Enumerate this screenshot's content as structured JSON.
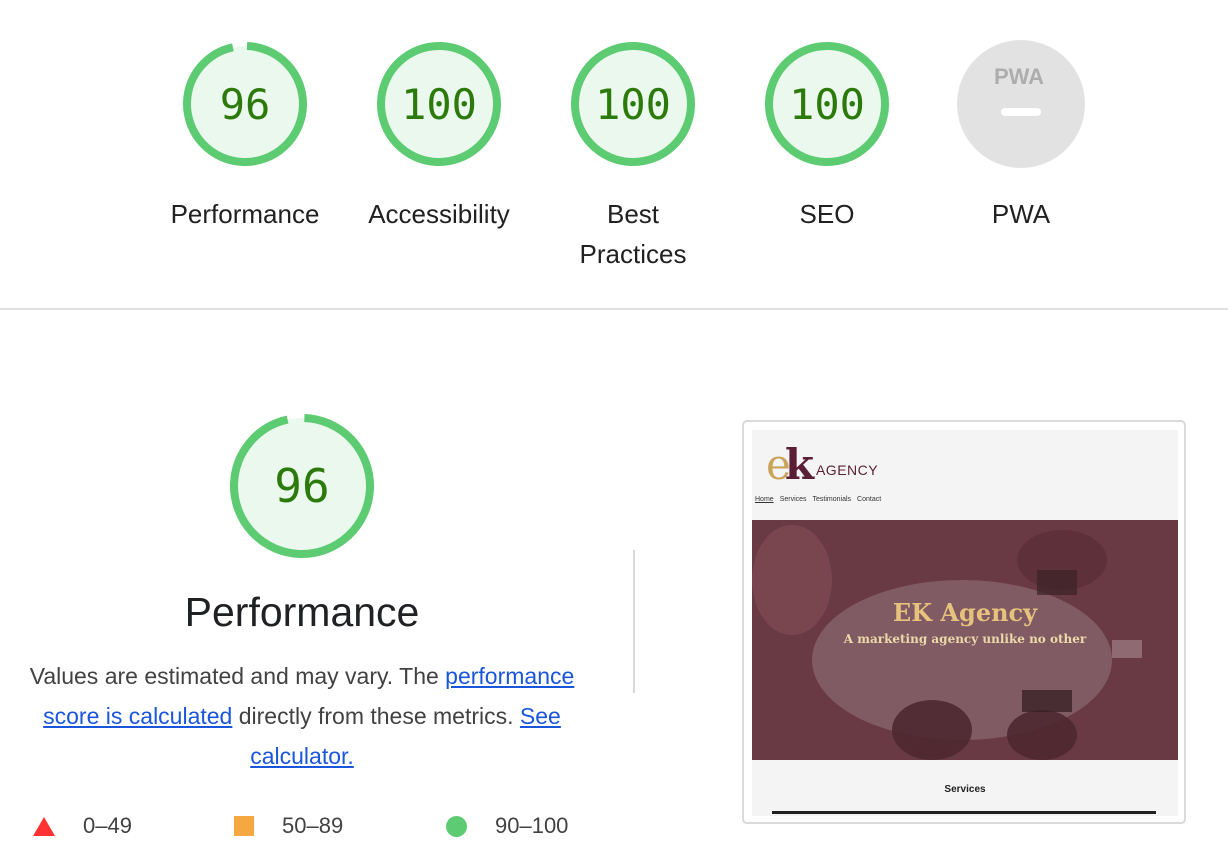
{
  "categories": [
    {
      "label": "Performance",
      "score": "96",
      "value": 96
    },
    {
      "label": "Accessibility",
      "score": "100",
      "value": 100
    },
    {
      "label": "Best Practices",
      "score": "100",
      "value": 100
    },
    {
      "label": "SEO",
      "score": "100",
      "value": 100
    },
    {
      "label": "PWA",
      "badge": "PWA"
    }
  ],
  "performance": {
    "score": "96",
    "value": 96,
    "title": "Performance",
    "desc_prefix": "Values are estimated and may vary. The ",
    "link_score": "performance score is calculated",
    "desc_middle": " directly from these metrics. ",
    "link_calculator": "See calculator."
  },
  "legend": [
    {
      "range": "0–49",
      "shape": "triangle",
      "color": "#ff3333"
    },
    {
      "range": "50–89",
      "shape": "square",
      "color": "#f5a742"
    },
    {
      "range": "90–100",
      "shape": "circle",
      "color": "#5ccb71"
    }
  ],
  "screenshot": {
    "logo_e": "e",
    "logo_k": "k",
    "logo_text": "AGENCY",
    "nav": [
      "Home",
      "Services",
      "Testimonials",
      "Contact"
    ],
    "hero_title": "EK Agency",
    "hero_subtitle": "A marketing agency unlike no other",
    "section_title": "Services"
  },
  "colors": {
    "pass_ring": "#5ccb71",
    "pass_fill": "#eaf8ed",
    "pass_text": "#2b7a0b",
    "na_fill": "#e2e2e2",
    "na_text": "#adadad"
  }
}
